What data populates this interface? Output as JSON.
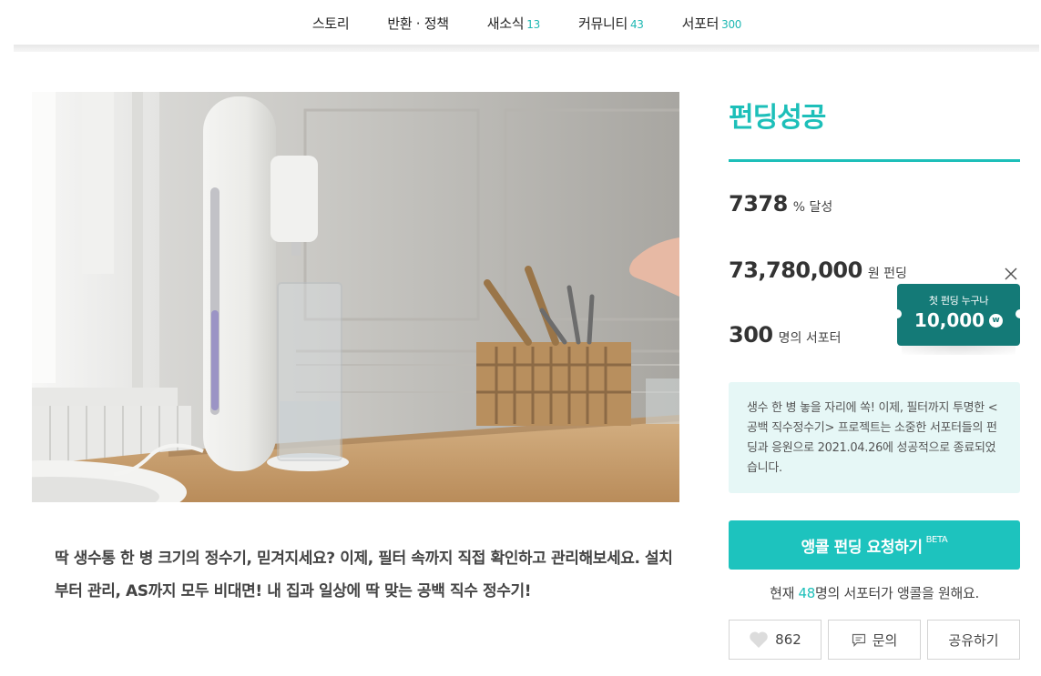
{
  "nav": {
    "items": [
      {
        "label": "스토리",
        "count": ""
      },
      {
        "label": "반환 · 정책",
        "count": ""
      },
      {
        "label": "새소식",
        "count": "13"
      },
      {
        "label": "커뮤니티",
        "count": "43"
      },
      {
        "label": "서포터",
        "count": "300"
      }
    ]
  },
  "story": {
    "description": "딱 생수통 한 병 크기의 정수기, 믿겨지세요? 이제, 필터 속까지 직접 확인하고 관리해보세요. 설치부터 관리, AS까지 모두 비대면! 내 집과 일상에 딱 맞는 공백 직수 정수기!"
  },
  "funding": {
    "status": "펀딩성공",
    "achievement": {
      "value": "7378",
      "unit": "% 달성"
    },
    "amount": {
      "value": "73,780,000",
      "unit": "원 펀딩"
    },
    "supporters": {
      "value": "300",
      "unit": "명의 서포터"
    },
    "notice": "생수 한 병 놓을 자리에 쏙! 이제, 필터까지 투명한 <공백 직수정수기> 프로젝트는 소중한 서포터들의 펀딩과 응원으로 2021.04.26에 성공적으로 종료되었습니다."
  },
  "promo": {
    "label": "첫 펀딩 누구나",
    "amount": "10,000",
    "coin": "w"
  },
  "encore": {
    "button_label": "앵콜 펀딩 요청하기",
    "beta": "BETA",
    "note_prefix": "현재 ",
    "note_count": "48",
    "note_suffix": "명의 서포터가 앵콜을 원해요."
  },
  "actions": {
    "like_count": "862",
    "inquiry_label": "문의",
    "share_label": "공유하기"
  },
  "colors": {
    "accent": "#1dbfb9",
    "badge": "#147a77",
    "notice_bg": "#e6f7f6"
  }
}
